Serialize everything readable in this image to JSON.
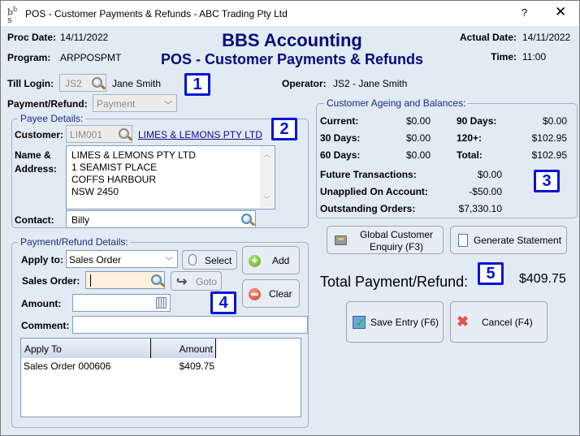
{
  "window": {
    "title": "POS - Customer Payments & Refunds - ABC Trading Pty Ltd",
    "help_label": "?",
    "close_label": "✕",
    "app_icon": "bsb-logo-icon"
  },
  "header": {
    "proc_date_label": "Proc Date:",
    "proc_date": "14/11/2022",
    "program_label": "Program:",
    "program": "ARPPOSPMT",
    "app_title": "BBS Accounting",
    "screen_title": "POS - Customer Payments & Refunds",
    "actual_date_label": "Actual Date:",
    "actual_date": "14/11/2022",
    "time_label": "Time:",
    "time": "11:00"
  },
  "till": {
    "till_login_label": "Till Login:",
    "till_login_value": "JS2",
    "till_user_name": "Jane Smith",
    "operator_label": "Operator:",
    "operator_value": "JS2 - Jane Smith",
    "payment_refund_label": "Payment/Refund:",
    "payment_refund_value": "Payment"
  },
  "payee": {
    "group_title": "Payee Details:",
    "customer_label": "Customer:",
    "customer_code": "LIM001",
    "customer_name_link": "LIMES & LEMONS PTY LTD",
    "name_address_label_1": "Name &",
    "name_address_label_2": "Address:",
    "address_lines": [
      "LIMES & LEMONS PTY LTD",
      "1 SEAMIST PLACE",
      "COFFS HARBOUR",
      "NSW 2450"
    ],
    "contact_label": "Contact:",
    "contact_value": "Billy"
  },
  "ageing": {
    "group_title": "Customer Ageing and Balances:",
    "current_label": "Current:",
    "current": "$0.00",
    "d30_label": "30 Days:",
    "d30": "$0.00",
    "d60_label": "60 Days:",
    "d60": "$0.00",
    "d90_label": "90 Days:",
    "d90": "$0.00",
    "d120_label": "120+:",
    "d120": "$102.95",
    "total_label": "Total:",
    "total": "$102.95",
    "future_label": "Future Transactions:",
    "future": "$0.00",
    "unapplied_label": "Unapplied On Account:",
    "unapplied": "-$50.00",
    "outstanding_label": "Outstanding Orders:",
    "outstanding": "$7,330.10"
  },
  "actions": {
    "global_enquiry_line1": "Global Customer",
    "global_enquiry_line2": "Enquiry (F3)",
    "generate_statement": "Generate Statement",
    "total_label": "Total Payment/Refund:",
    "total_value": "$409.75",
    "save_entry": "Save Entry (F6)",
    "cancel": "Cancel (F4)"
  },
  "details": {
    "group_title": "Payment/Refund Details:",
    "apply_to_label": "Apply to:",
    "apply_to_value": "Sales Order",
    "select_button": "Select",
    "add_button": "Add",
    "sales_order_label": "Sales Order:",
    "sales_order_value": "",
    "goto_button": "Goto",
    "clear_button": "Clear",
    "amount_label": "Amount:",
    "amount_value": "",
    "comment_label": "Comment:",
    "comment_value": "",
    "grid": {
      "columns": [
        "Apply To",
        "Amount"
      ],
      "rows": [
        {
          "apply_to": "Sales Order 000606",
          "amount": "$409.75"
        }
      ]
    }
  },
  "badges": [
    "1",
    "2",
    "3",
    "4",
    "5"
  ]
}
